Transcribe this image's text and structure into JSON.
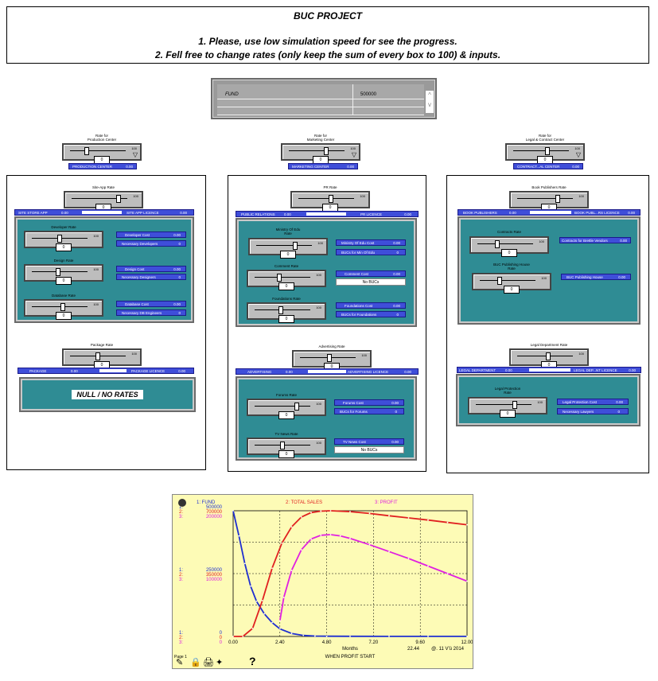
{
  "banner": {
    "title": "BUC PROJECT",
    "line1": "1. Please, use low simulation speed for see the progress.",
    "line2": "2. Fell free to change rates (only keep the sum of every box to 100) & inputs."
  },
  "fund_table": {
    "label": "FUND",
    "value": "500000",
    "scroll_up": "^",
    "scroll_down": "v"
  },
  "centers": [
    {
      "label": "Rate for\nProduction Center",
      "bar": "PRODUCTION CENTER",
      "bar_value": "0.00"
    },
    {
      "label": "Rate for\nMarketing Center",
      "bar": "MARKETING CENTER",
      "bar_value": "0.00"
    },
    {
      "label": "Rate for\nLegal & Contract Center",
      "bar": "CONTRACT...AL CENTER",
      "bar_value": "0.00"
    }
  ],
  "prod": {
    "site": {
      "label": "Site-App Rate",
      "bar1": "SITE STORE APP",
      "v1": "0.00",
      "bar2": "SITE APP LICENCE",
      "v2": "0.00"
    },
    "developer": {
      "label": "Developer Rate",
      "cost_label": "Developer Cost",
      "cost_value": "0.00",
      "need_label": "Necessary Developers",
      "need_value": "0"
    },
    "design": {
      "label": "Design Rate",
      "cost_label": "Design Cost",
      "cost_value": "0.00",
      "need_label": "Necessary Designers",
      "need_value": "0"
    },
    "database": {
      "label": "Database Rate",
      "cost_label": "Database Cost",
      "cost_value": "0.00",
      "need_label": "Necessary DB Engineers",
      "need_value": "0"
    },
    "package": {
      "label": "Package Rate",
      "bar1": "PACKAGE",
      "v1": "0.00",
      "bar2": "PACKAGE LICENCE",
      "v2": "0.00",
      "null_text": "NULL / NO RATES"
    }
  },
  "mkt": {
    "pr": {
      "label": "PR Rate",
      "bar1": "PUBLIC RELATIONS",
      "v1": "0.00",
      "bar2": "PR LICENCE",
      "v2": "0.00"
    },
    "ministry": {
      "label": "Ministry Of Edu\nRate",
      "cost_label": "Ministry Of Edu Cost",
      "cost_value": "0.00",
      "bucs_label": "BUCs for Min Of Edu",
      "bucs_value": "0"
    },
    "comment": {
      "label": "Comment Rate",
      "cost_label": "Comment Cost",
      "cost_value": "0.00",
      "no_bucs": "No BUCs"
    },
    "foundations": {
      "label": "Foundations Rate",
      "cost_label": "Foundations Cost",
      "cost_value": "0.00",
      "bucs_label": "BUCs for Foundations",
      "bucs_value": "0"
    },
    "advertising": {
      "label": "Advertising Rate",
      "bar1": "ADVERTISING",
      "v1": "0.00",
      "bar2": "ADVERTISING LICENCE",
      "v2": "0.00"
    },
    "forums": {
      "label": "Forums Rate",
      "cost_label": "Forums Cost",
      "cost_value": "0.00",
      "bucs_label": "BUCs for Forums",
      "bucs_value": "0"
    },
    "tvnews": {
      "label": "TV News Rate",
      "cost_label": "TV News Cost",
      "cost_value": "0.00",
      "no_bucs": "No BUCs"
    }
  },
  "legal": {
    "book": {
      "label": "Book Publishers Rate",
      "bar1": "BOOK PUBLISHERS",
      "v1": "0.00",
      "bar2": "BOOK PUBL...RS LICENCE",
      "v2": "0.00"
    },
    "contracts": {
      "label": "Contracts Rate",
      "cost_label": "Contracts for Brettle Vendors",
      "cost_value": "0.00"
    },
    "bucpub": {
      "label": "BUC Publishing House\nRate",
      "cost_label": "BUC Publishing House",
      "cost_value": "0.00"
    },
    "legaldept": {
      "label": "Legal Department Rate",
      "bar1": "LEGAL DEPARTMENT",
      "v1": "0.00",
      "bar2": "LEGAL DEP...NT LICENCE",
      "v2": "0.00"
    },
    "protection": {
      "label": "Legal Protection\nRate",
      "cost_label": "Legal Protection Cost",
      "cost_value": "0.00",
      "need_label": "Necessary Lawyers",
      "need_value": "0"
    }
  },
  "slider_values": {
    "center": "0",
    "site": "0",
    "developer": "0",
    "design": "0",
    "database": "0",
    "package": "0",
    "pr": "0",
    "ministry": "0",
    "comment": "0",
    "foundations": "0",
    "advertising": "0",
    "forums": "0",
    "tvnews": "0",
    "book": "0",
    "contracts": "0",
    "bucpub": "0",
    "legaldept": "0",
    "protection": "0",
    "slider_max": "100"
  },
  "chart_data": {
    "type": "line",
    "series": [
      {
        "name": "1: FUND",
        "color": "#1f2fd0",
        "x": [
          0,
          0.3,
          0.6,
          0.9,
          1.2,
          1.6,
          2.0,
          2.4,
          3.0,
          3.6,
          4.2,
          4.8,
          6,
          8,
          10,
          12
        ],
        "values": [
          500000,
          400000,
          290000,
          200000,
          140000,
          90000,
          55000,
          30000,
          12000,
          4000,
          1500,
          800,
          500,
          400,
          400,
          400
        ]
      },
      {
        "name": "2: TOTAL SALES",
        "color": "#e02020",
        "x": [
          0,
          0.5,
          1,
          1.5,
          2,
          2.5,
          3,
          3.5,
          4,
          4.5,
          5,
          6,
          7,
          8,
          9,
          10,
          11,
          12
        ],
        "values": [
          0,
          0,
          45000,
          200000,
          380000,
          520000,
          610000,
          665000,
          690000,
          698000,
          700000,
          695000,
          685000,
          672000,
          660000,
          648000,
          635000,
          622000
        ]
      },
      {
        "name": "3: PROFIT",
        "color": "#e020e0",
        "x": [
          2.4,
          2.6,
          3,
          3.5,
          4,
          4.5,
          5,
          5.5,
          6,
          7,
          8,
          9,
          10,
          11,
          12
        ],
        "values": [
          25000,
          62000,
          105000,
          138000,
          155000,
          161000,
          162000,
          160000,
          156000,
          146000,
          135000,
          124000,
          112000,
          100000,
          88000
        ]
      }
    ],
    "axis_labels": {
      "y1": [
        "500000",
        "250000",
        "0"
      ],
      "y2": [
        "700000",
        "350000",
        "0"
      ],
      "y3": [
        "200000",
        "100000",
        "0"
      ]
    },
    "y_index_labels": [
      "1:",
      "2:",
      "3:"
    ],
    "x_ticks": [
      "0.00",
      "2.40",
      "4.80",
      "7.20",
      "9.60",
      "12.00"
    ],
    "xlabel": "Months",
    "caption": "WHEN PROFIT START",
    "footer_left": "22.44",
    "footer_right": "@. 11 V'ü 2014",
    "page_label": "Page 1",
    "help": "?"
  }
}
